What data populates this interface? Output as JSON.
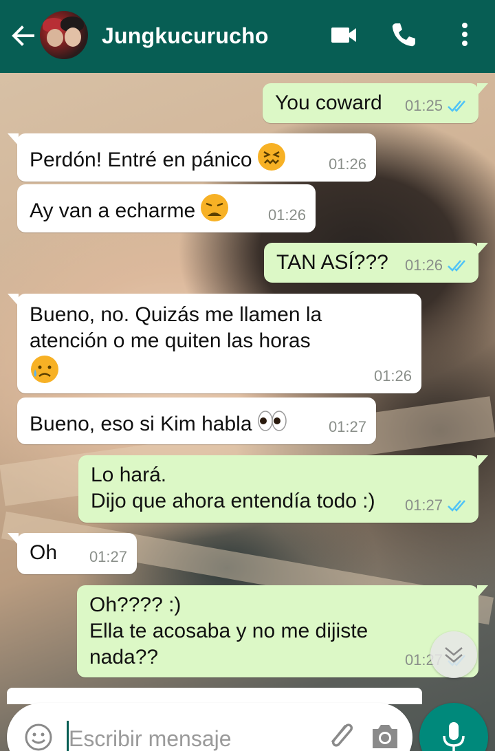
{
  "header": {
    "contact_name": "Jungkucurucho",
    "icons": [
      "back-arrow-icon",
      "video-call-icon",
      "phone-icon",
      "more-vert-icon"
    ]
  },
  "messages": [
    {
      "direction": "out",
      "text": "You coward",
      "time": "01:25",
      "status": "read"
    },
    {
      "direction": "in",
      "text": "Perdón! Entré en pánico",
      "emoji": "confounded-face",
      "time": "01:26"
    },
    {
      "direction": "in",
      "text": "Ay van a echarme",
      "emoji": "weary-face",
      "time": "01:26"
    },
    {
      "direction": "out",
      "text": "TAN ASÍ???",
      "time": "01:26",
      "status": "read"
    },
    {
      "direction": "in",
      "text": "Bueno, no. Quizás me llamen la\natención o me quiten las horas",
      "emoji": "sad-but-relieved-face",
      "time": "01:26"
    },
    {
      "direction": "in",
      "text": "Bueno, eso si Kim habla",
      "emoji": "eyes",
      "time": "01:27"
    },
    {
      "direction": "out",
      "text": "Lo hará.\nDijo que ahora entendía todo :)",
      "time": "01:27",
      "status": "read"
    },
    {
      "direction": "in",
      "text": "Oh",
      "time": "01:27"
    },
    {
      "direction": "out",
      "text": "Oh???? :)\nElla te acosaba y no me dijiste\nnada??",
      "time": "01:27",
      "status": "read"
    }
  ],
  "composer": {
    "placeholder": "Escribir mensaje",
    "value": ""
  },
  "colors": {
    "header_bg": "#075e54",
    "outgoing_bubble": "#dcf8c6",
    "incoming_bubble": "#ffffff",
    "read_ticks": "#4fc3f7",
    "mic_button": "#00897b"
  }
}
